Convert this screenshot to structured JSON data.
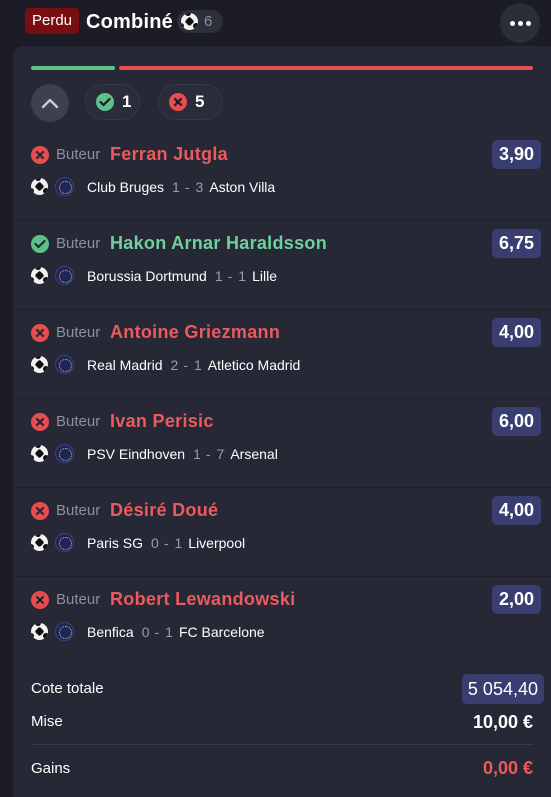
{
  "header": {
    "status": "Perdu",
    "title": "Combiné",
    "selections_count": "6"
  },
  "summary": {
    "won_count": "1",
    "lost_count": "5",
    "progress_won_fraction": 0.167
  },
  "bets": [
    {
      "market": "Buteur",
      "selection": "Ferran Jutgla",
      "result": "lost",
      "odds": "3,90",
      "home": "Club Bruges",
      "home_score": "1",
      "away_score": "3",
      "away": "Aston Villa"
    },
    {
      "market": "Buteur",
      "selection": "Hakon Arnar Haraldsson",
      "result": "won",
      "odds": "6,75",
      "home": "Borussia Dortmund",
      "home_score": "1",
      "away_score": "1",
      "away": "Lille"
    },
    {
      "market": "Buteur",
      "selection": "Antoine Griezmann",
      "result": "lost",
      "odds": "4,00",
      "home": "Real Madrid",
      "home_score": "2",
      "away_score": "1",
      "away": "Atletico Madrid"
    },
    {
      "market": "Buteur",
      "selection": "Ivan Perisic",
      "result": "lost",
      "odds": "6,00",
      "home": "PSV Eindhoven",
      "home_score": "1",
      "away_score": "7",
      "away": "Arsenal"
    },
    {
      "market": "Buteur",
      "selection": "Désiré Doué",
      "result": "lost",
      "odds": "4,00",
      "home": "Paris SG",
      "home_score": "0",
      "away_score": "1",
      "away": "Liverpool"
    },
    {
      "market": "Buteur",
      "selection": "Robert Lewandowski",
      "result": "lost",
      "odds": "2,00",
      "home": "Benfica",
      "home_score": "0",
      "away_score": "1",
      "away": "FC Barcelone"
    }
  ],
  "totals": {
    "total_odds_label": "Cote totale",
    "total_odds": "5 054,40",
    "stake_label": "Mise",
    "stake": "10,00 €",
    "winnings_label": "Gains",
    "winnings": "0,00 €"
  },
  "colors": {
    "won": "#5cc28a",
    "lost": "#e64c50",
    "odds_badge": "#3a3d70",
    "status_badge": "#7a0d12"
  },
  "icons": {
    "sport": "soccer-ball-icon",
    "league": "champions-league-icon",
    "won": "check-circle-icon",
    "lost": "cross-circle-icon",
    "more": "more-dots-icon",
    "collapse": "chevron-up-icon"
  }
}
